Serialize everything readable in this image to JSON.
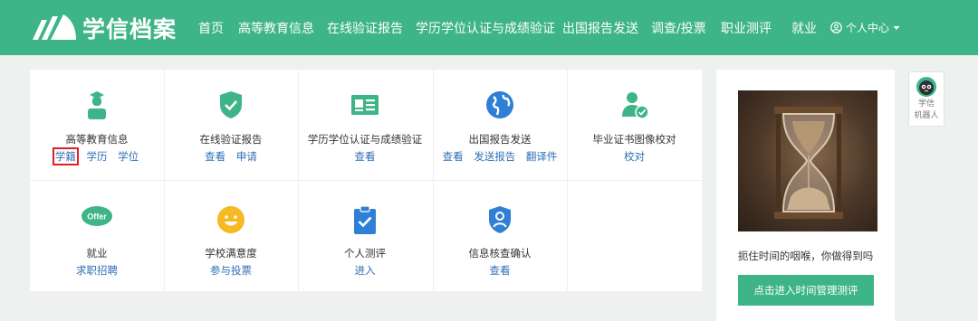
{
  "header": {
    "logo_text": "学信档案",
    "nav": [
      {
        "label": "首页"
      },
      {
        "label": "高等教育信息"
      },
      {
        "label": "在线验证报告"
      },
      {
        "label": "学历学位认证与成绩验证"
      },
      {
        "label": "出国报告发送"
      },
      {
        "label": "调查/投票"
      },
      {
        "label": "职业测评"
      },
      {
        "label": "就业"
      }
    ],
    "user_center": "个人中心"
  },
  "tiles": [
    {
      "label": "高等教育信息",
      "links": [
        "学籍",
        "学历",
        "学位"
      ],
      "icon": "graduate-icon"
    },
    {
      "label": "在线验证报告",
      "links": [
        "查看",
        "申请"
      ],
      "icon": "shield-check-icon"
    },
    {
      "label": "学历学位认证与成绩验证",
      "links": [
        "查看"
      ],
      "icon": "id-card-icon"
    },
    {
      "label": "出国报告发送",
      "links": [
        "查看",
        "发送报告",
        "翻译件"
      ],
      "icon": "globe-icon"
    },
    {
      "label": "毕业证书图像校对",
      "links": [
        "校对"
      ],
      "icon": "user-check-icon"
    },
    {
      "label": "就业",
      "links": [
        "求职招聘"
      ],
      "icon": "offer-icon",
      "icon_text": "Offer"
    },
    {
      "label": "学校满意度",
      "links": [
        "参与投票"
      ],
      "icon": "smiley-icon"
    },
    {
      "label": "个人测评",
      "links": [
        "进入"
      ],
      "icon": "clipboard-check-icon"
    },
    {
      "label": "信息核查确认",
      "links": [
        "查看"
      ],
      "icon": "user-shield-icon"
    }
  ],
  "side": {
    "caption": "扼住时间的咽喉，你做得到吗",
    "button": "点击进入时间管理测评"
  },
  "robot": {
    "line1": "学信",
    "line2": "机器人"
  },
  "colors": {
    "brand": "#3eb489",
    "link": "#2f6fb5",
    "highlight": "#e02020"
  }
}
